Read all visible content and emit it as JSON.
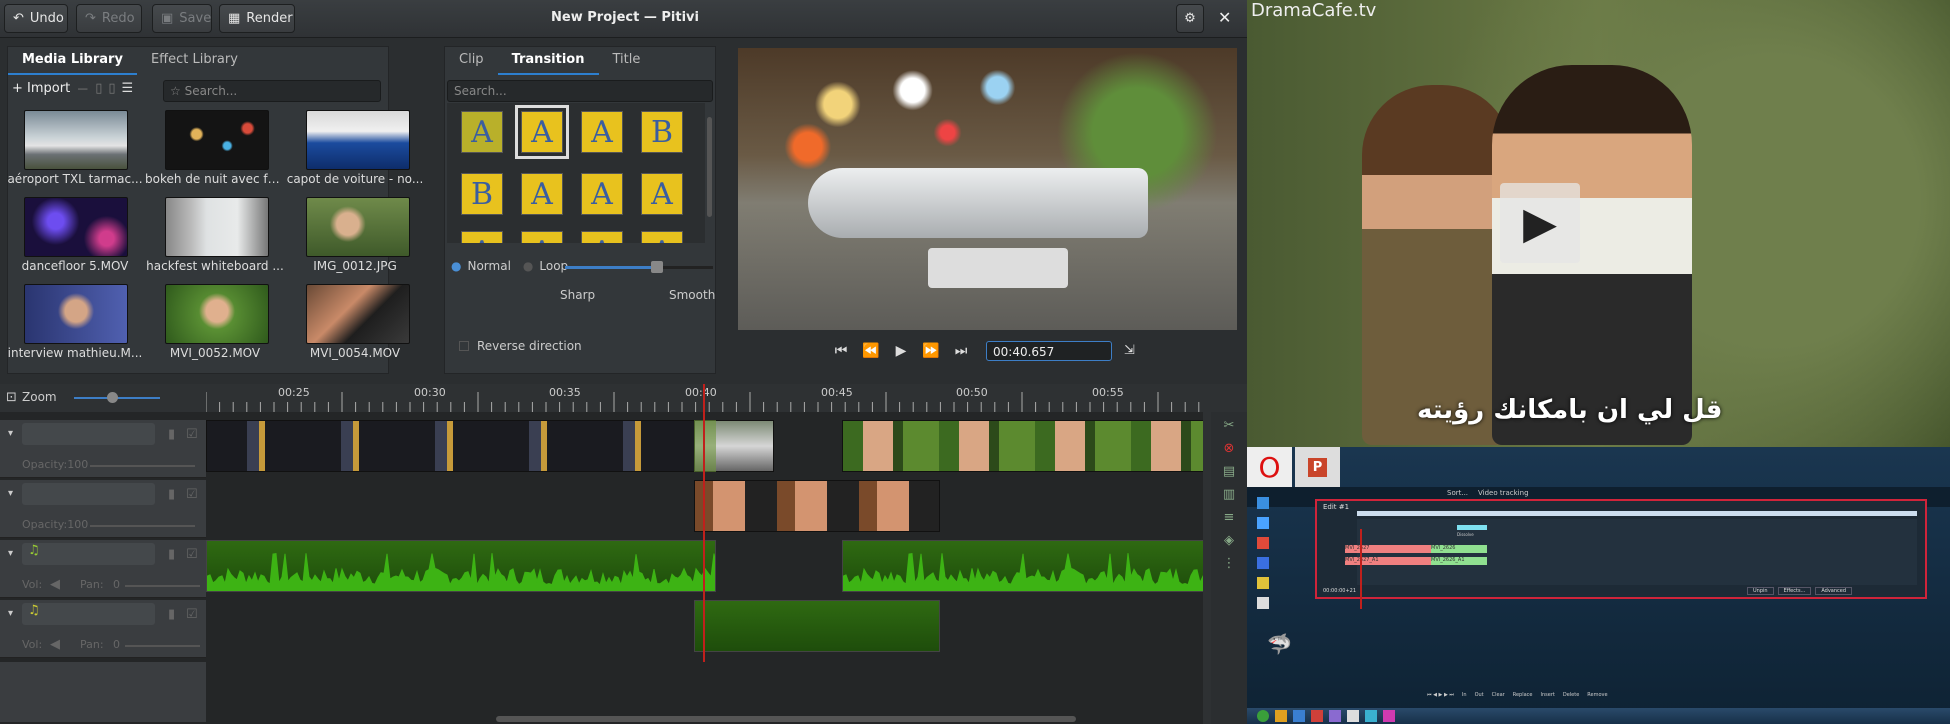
{
  "header": {
    "undo": "Undo",
    "redo": "Redo",
    "save": "Save",
    "render": "Render",
    "window_title": "New Project — Pitivi"
  },
  "library": {
    "tabs": [
      "Media Library",
      "Effect Library"
    ],
    "import": "Import",
    "search_placeholder": "Search...",
    "items": [
      {
        "label": "aéroport TXL tarmac..."
      },
      {
        "label": "bokeh de nuit avec fo..."
      },
      {
        "label": "capot de voiture - no..."
      },
      {
        "label": "dancefloor 5.MOV"
      },
      {
        "label": "hackfest whiteboard ..."
      },
      {
        "label": "IMG_0012.JPG"
      },
      {
        "label": "interview mathieu.M..."
      },
      {
        "label": "MVI_0052.MOV"
      },
      {
        "label": "MVI_0054.MOV"
      }
    ]
  },
  "transition": {
    "tabs": [
      "Clip",
      "Transition",
      "Title"
    ],
    "search_placeholder": "Search...",
    "mode_normal": "Normal",
    "mode_loop": "Loop",
    "sharp": "Sharp",
    "smooth": "Smooth",
    "reverse": "Reverse direction",
    "softness": 0.62
  },
  "viewer": {
    "timecode": "00:40.657"
  },
  "timeline": {
    "zoom": "Zoom",
    "ruler": [
      "00:25",
      "00:30",
      "00:35",
      "00:40",
      "00:45",
      "00:50",
      "00:55"
    ],
    "opacity1": "Opacity:100",
    "opacity2": "Opacity:100",
    "vol": "Vol:",
    "pan": "Pan:",
    "pan_val": "0"
  },
  "video": {
    "watermark": "DramaCafe.tv",
    "subtitle": "قل لي ان بامكانك رؤيته"
  },
  "desktop": {
    "title": "Edit #1",
    "btns": [
      "Unpin",
      "Effects...",
      "Advanced"
    ],
    "clips": [
      "MVI_2627",
      "MVI_2626",
      "MVI_2627_A1",
      "MVI_2626_A1",
      "Dissolve"
    ],
    "toolbar": [
      "In",
      "Out",
      "Clear",
      "Replace",
      "Insert",
      "Delete",
      "Remove"
    ],
    "time": "00:00:00+21",
    "tabs": [
      "Sort...",
      "Video tracking"
    ]
  }
}
